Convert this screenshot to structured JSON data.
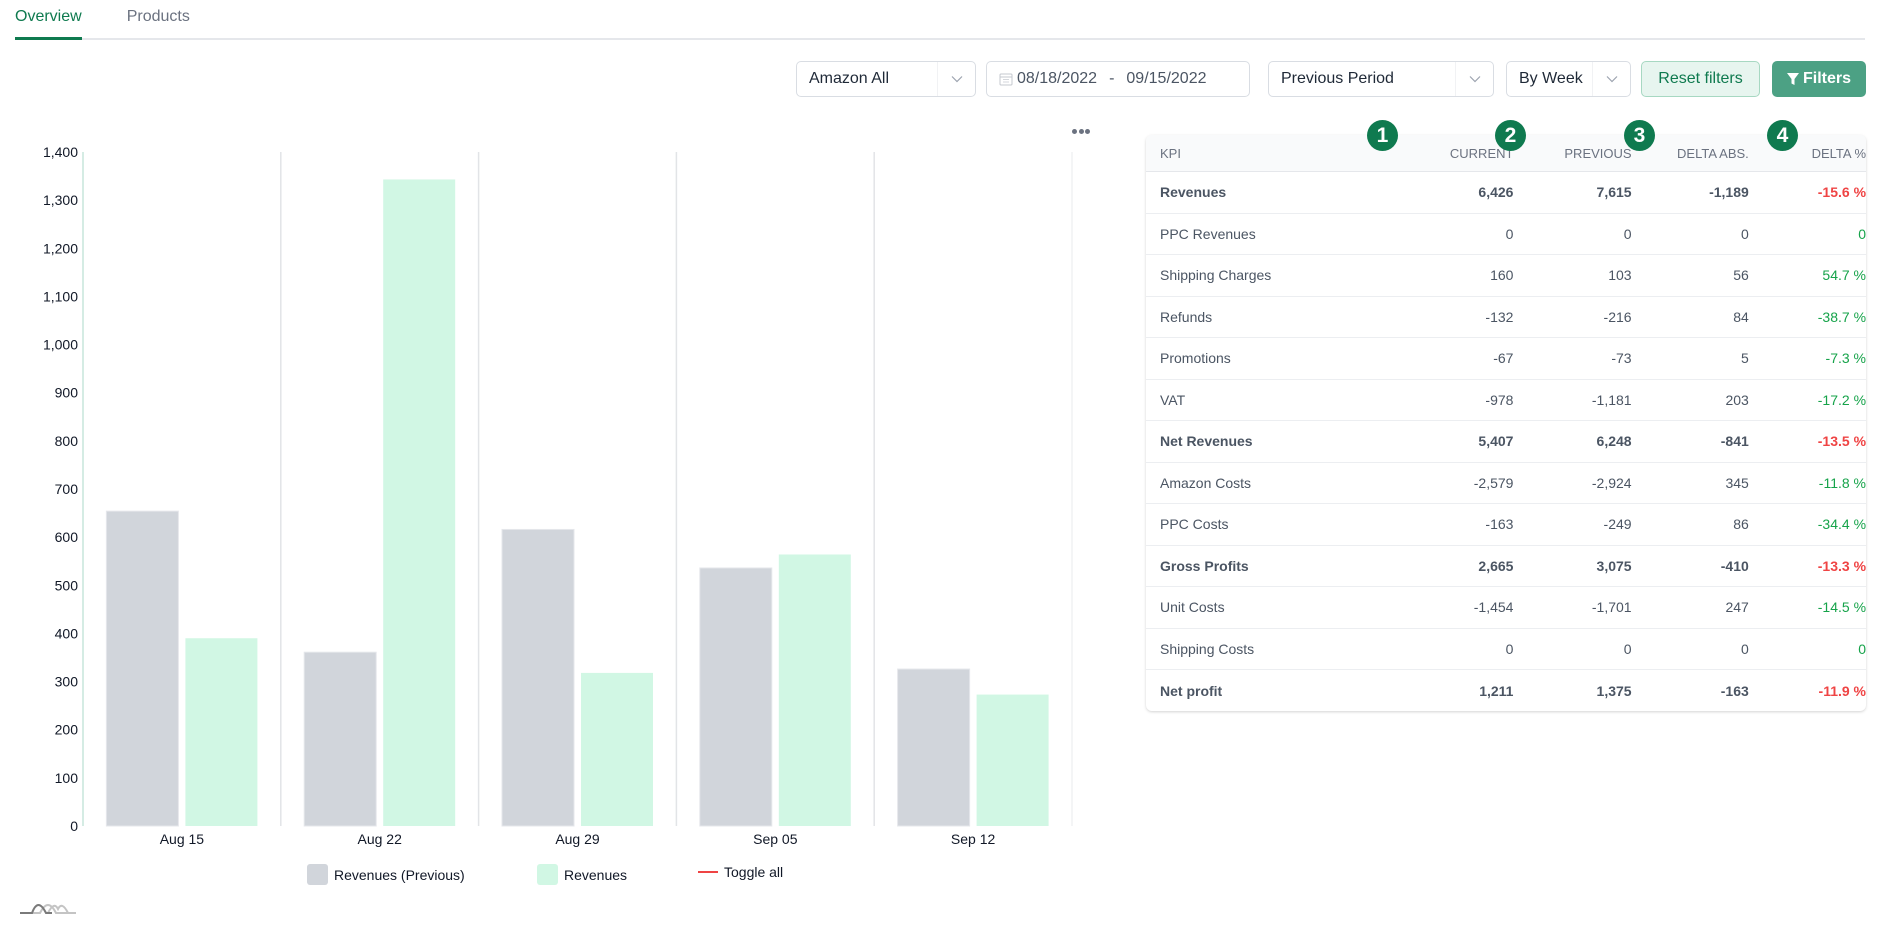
{
  "tabs": [
    {
      "label": "Overview",
      "active": true
    },
    {
      "label": "Products",
      "active": false
    }
  ],
  "filters": {
    "marketplace": "Amazon All",
    "date_start": "08/18/2022",
    "date_separator": "-",
    "date_end": "09/15/2022",
    "comparison": "Previous Period",
    "granularity": "By Week",
    "reset_label": "Reset filters",
    "filters_label": "Filters"
  },
  "colors": {
    "accent": "#0f7a4f",
    "filters_button": "#4ca184",
    "previous_bar": "#d1d5db",
    "current_bar": "#d1f7e4",
    "negative": "#ef4444",
    "positive": "#16a34a"
  },
  "chart_data": {
    "type": "bar",
    "title": "",
    "xlabel": "",
    "ylabel": "",
    "categories": [
      "Aug 15",
      "Aug 22",
      "Aug 29",
      "Sep 05",
      "Sep 12"
    ],
    "series": [
      {
        "name": "Revenues (Previous)",
        "values": [
          654,
          361,
          616,
          536,
          326
        ]
      },
      {
        "name": "Revenues",
        "values": [
          390,
          1343,
          318,
          564,
          273
        ]
      }
    ],
    "ylim": [
      0,
      1400
    ],
    "yticks": [
      0,
      100,
      200,
      300,
      400,
      500,
      600,
      700,
      800,
      900,
      1000,
      1100,
      1200,
      1300,
      1400
    ],
    "ytick_labels": [
      "0",
      "100",
      "200",
      "300",
      "400",
      "500",
      "600",
      "700",
      "800",
      "900",
      "1,000",
      "1,100",
      "1,200",
      "1,300",
      "1,400"
    ],
    "grid": "vertical category separators",
    "legend": {
      "position": "bottom",
      "items": [
        "Revenues (Previous)",
        "Revenues",
        "Toggle all"
      ]
    }
  },
  "kpi_table": {
    "badges": [
      "1",
      "2",
      "3",
      "4"
    ],
    "headers": [
      "KPI",
      "CURRENT",
      "PREVIOUS",
      "DELTA ABS.",
      "DELTA %"
    ],
    "rows": [
      {
        "kpi": "Revenues",
        "current": "6,426",
        "previous": "7,615",
        "delta_abs": "-1,189",
        "delta_pct": "-15.6 %",
        "bold": true,
        "trend": "neg"
      },
      {
        "kpi": "PPC Revenues",
        "current": "0",
        "previous": "0",
        "delta_abs": "0",
        "delta_pct": "0",
        "bold": false,
        "trend": "pos"
      },
      {
        "kpi": "Shipping Charges",
        "current": "160",
        "previous": "103",
        "delta_abs": "56",
        "delta_pct": "54.7 %",
        "bold": false,
        "trend": "pos"
      },
      {
        "kpi": "Refunds",
        "current": "-132",
        "previous": "-216",
        "delta_abs": "84",
        "delta_pct": "-38.7 %",
        "bold": false,
        "trend": "pos"
      },
      {
        "kpi": "Promotions",
        "current": "-67",
        "previous": "-73",
        "delta_abs": "5",
        "delta_pct": "-7.3 %",
        "bold": false,
        "trend": "pos"
      },
      {
        "kpi": "VAT",
        "current": "-978",
        "previous": "-1,181",
        "delta_abs": "203",
        "delta_pct": "-17.2 %",
        "bold": false,
        "trend": "pos"
      },
      {
        "kpi": "Net Revenues",
        "current": "5,407",
        "previous": "6,248",
        "delta_abs": "-841",
        "delta_pct": "-13.5 %",
        "bold": true,
        "trend": "neg"
      },
      {
        "kpi": "Amazon Costs",
        "current": "-2,579",
        "previous": "-2,924",
        "delta_abs": "345",
        "delta_pct": "-11.8 %",
        "bold": false,
        "trend": "pos"
      },
      {
        "kpi": "PPC Costs",
        "current": "-163",
        "previous": "-249",
        "delta_abs": "86",
        "delta_pct": "-34.4 %",
        "bold": false,
        "trend": "pos"
      },
      {
        "kpi": "Gross Profits",
        "current": "2,665",
        "previous": "3,075",
        "delta_abs": "-410",
        "delta_pct": "-13.3 %",
        "bold": true,
        "trend": "neg"
      },
      {
        "kpi": "Unit Costs",
        "current": "-1,454",
        "previous": "-1,701",
        "delta_abs": "247",
        "delta_pct": "-14.5 %",
        "bold": false,
        "trend": "pos"
      },
      {
        "kpi": "Shipping Costs",
        "current": "0",
        "previous": "0",
        "delta_abs": "0",
        "delta_pct": "0",
        "bold": false,
        "trend": "pos"
      },
      {
        "kpi": "Net profit",
        "current": "1,211",
        "previous": "1,375",
        "delta_abs": "-163",
        "delta_pct": "-11.9 %",
        "bold": true,
        "trend": "neg"
      }
    ]
  },
  "icons": {
    "calendar": "calendar-icon",
    "chevron": "chevron-down-icon",
    "filter": "filter-icon",
    "more": "more-horizontal-icon",
    "logo": "mountain-logo-icon"
  }
}
